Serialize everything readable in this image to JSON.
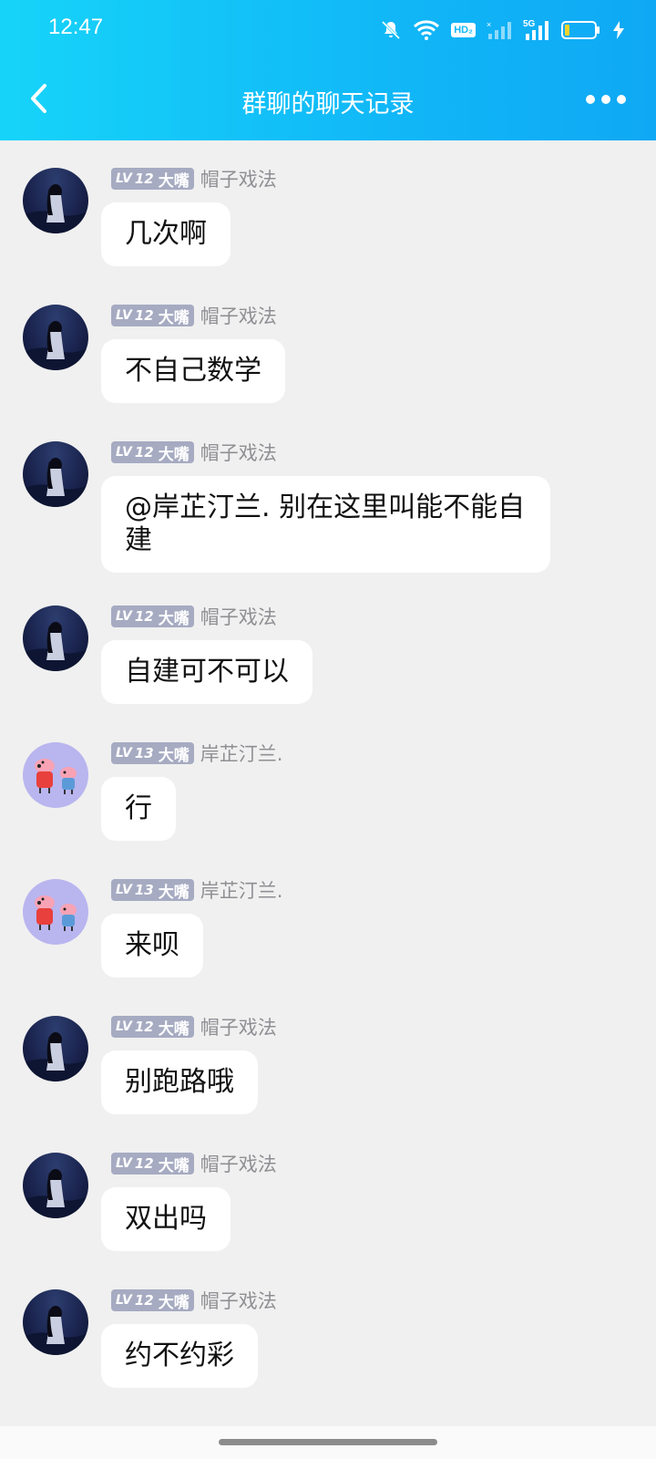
{
  "status_bar": {
    "time": "12:47",
    "icons": [
      "mute-bell-icon",
      "wifi-icon",
      "hd-voice-icon",
      "signal-sim1-icon",
      "signal-5g-icon",
      "battery-icon",
      "charging-icon"
    ],
    "hd_label": "HD₂",
    "net_label": "5G"
  },
  "header": {
    "title": "群聊的聊天记录",
    "back_icon": "chevron-left-icon",
    "more_icon": "more-dots-icon"
  },
  "colors": {
    "header_gradient_start": "#16d4f9",
    "header_gradient_end": "#0fa8f4",
    "badge_bg": "#a6abc2",
    "page_bg": "#f0f0f0"
  },
  "messages": [
    {
      "level": "12",
      "title": "大嘴",
      "sender": "帽子戏法",
      "avatar": "dark-figure",
      "text": "几次啊"
    },
    {
      "level": "12",
      "title": "大嘴",
      "sender": "帽子戏法",
      "avatar": "dark-figure",
      "text": "不自己数学"
    },
    {
      "level": "12",
      "title": "大嘴",
      "sender": "帽子戏法",
      "avatar": "dark-figure",
      "text": "@岸芷汀兰. 别在这里叫能不能自建"
    },
    {
      "level": "12",
      "title": "大嘴",
      "sender": "帽子戏法",
      "avatar": "dark-figure",
      "text": "自建可不可以"
    },
    {
      "level": "13",
      "title": "大嘴",
      "sender": "岸芷汀兰.",
      "avatar": "pig-cartoon",
      "text": "行"
    },
    {
      "level": "13",
      "title": "大嘴",
      "sender": "岸芷汀兰.",
      "avatar": "pig-cartoon",
      "text": "来呗"
    },
    {
      "level": "12",
      "title": "大嘴",
      "sender": "帽子戏法",
      "avatar": "dark-figure",
      "text": "别跑路哦"
    },
    {
      "level": "12",
      "title": "大嘴",
      "sender": "帽子戏法",
      "avatar": "dark-figure",
      "text": "双出吗"
    },
    {
      "level": "12",
      "title": "大嘴",
      "sender": "帽子戏法",
      "avatar": "dark-figure",
      "text": "约不约彩"
    }
  ],
  "lv_prefix": "LV"
}
